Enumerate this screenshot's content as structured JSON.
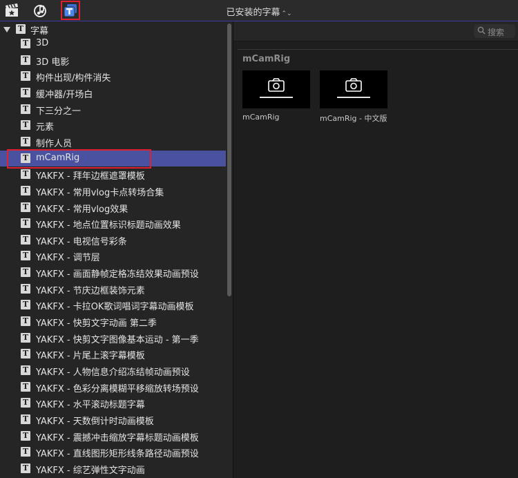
{
  "toolbar": {
    "title": "已安装的字幕",
    "title_chevron": "⌃⌄",
    "icons": [
      "clapperboard-star-icon",
      "music-notes-icon",
      "titles-icon"
    ],
    "selected_icon": "titles-icon",
    "highlight_color": "#e02030"
  },
  "sidebar": {
    "root_label": "字幕",
    "items": [
      {
        "label": "3D"
      },
      {
        "label": "3D 电影"
      },
      {
        "label": "构件出现/构件消失"
      },
      {
        "label": "缓冲器/开场白"
      },
      {
        "label": "下三分之一"
      },
      {
        "label": "元素"
      },
      {
        "label": "制作人员"
      },
      {
        "label": "mCamRig"
      },
      {
        "label": "YAKFX - 拜年边框遮罩模板"
      },
      {
        "label": "YAKFX - 常用vlog卡点转场合集"
      },
      {
        "label": "YAKFX - 常用vlog效果"
      },
      {
        "label": "YAKFX - 地点位置标识标题动画效果"
      },
      {
        "label": "YAKFX - 电视信号彩条"
      },
      {
        "label": "YAKFX - 调节层"
      },
      {
        "label": "YAKFX - 画面静帧定格冻结效果动画预设"
      },
      {
        "label": "YAKFX - 节庆边框装饰元素"
      },
      {
        "label": "YAKFX - 卡拉OK歌词唱词字幕动画模板"
      },
      {
        "label": "YAKFX - 快剪文字动画 第二季"
      },
      {
        "label": "YAKFX - 快剪文字图像基本运动 - 第一季"
      },
      {
        "label": "YAKFX - 片尾上滚字幕模板"
      },
      {
        "label": "YAKFX - 人物信息介绍冻结帧动画预设"
      },
      {
        "label": "YAKFX - 色彩分离模糊平移缩放转场预设"
      },
      {
        "label": "YAKFX - 水平滚动标题字幕"
      },
      {
        "label": "YAKFX - 天数倒计时动画模板"
      },
      {
        "label": "YAKFX - 震撼冲击缩放字幕标题动画模板"
      },
      {
        "label": "YAKFX - 直线图形矩形线条路径动画预设"
      },
      {
        "label": "YAKFX - 综艺弹性文字动画"
      }
    ],
    "selected_index": 7,
    "selected_color": "#4a52a0"
  },
  "browser": {
    "search_placeholder": "搜索",
    "section_title": "mCamRig",
    "tiles": [
      {
        "label": "mCamRig",
        "icon": "camera-icon"
      },
      {
        "label": "mCamRig - 中文版",
        "icon": "camera-icon"
      }
    ]
  }
}
